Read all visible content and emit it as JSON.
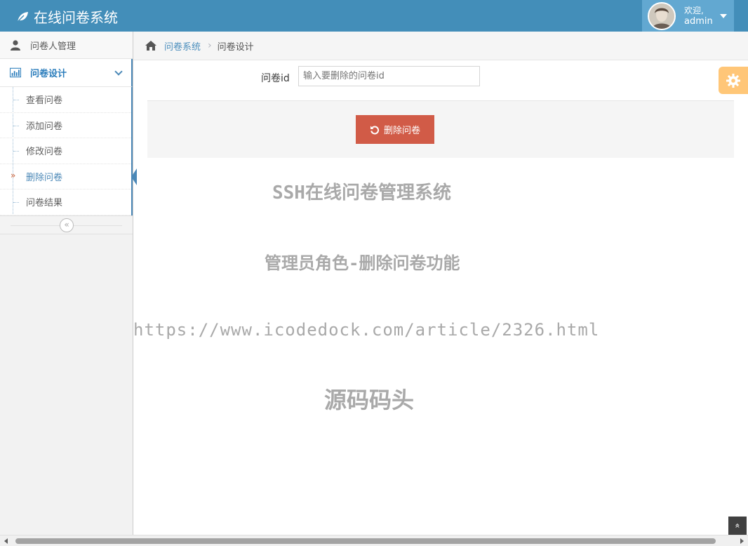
{
  "header": {
    "brand": "在线问卷系统",
    "brand_icon": "leaf-icon",
    "user_greeting": "欢迎,",
    "username": "admin"
  },
  "sidebar": {
    "items": [
      {
        "label": "问卷人管理",
        "icon": "user-icon"
      },
      {
        "label": "问卷设计",
        "icon": "bar-chart-icon",
        "open": true
      }
    ],
    "submenu": [
      {
        "label": "查看问卷"
      },
      {
        "label": "添加问卷"
      },
      {
        "label": "修改问卷"
      },
      {
        "label": "删除问卷",
        "active": true
      },
      {
        "label": "问卷结果"
      }
    ],
    "collapse_icon": "double-chevron-left-icon"
  },
  "breadcrumb": {
    "home_icon": "home-icon",
    "link": "问卷系统",
    "current": "问卷设计"
  },
  "form": {
    "label": "问卷id",
    "input_placeholder": "输入要删除的问卷id",
    "input_value": "",
    "delete_label": "删除问卷",
    "delete_icon": "undo-icon"
  },
  "watermark": {
    "line1": "SSH在线问卷管理系统",
    "line2": "管理员角色-删除问卷功能",
    "line3": "https://www.icodedock.com/article/2326.html",
    "line4": "源码码头"
  },
  "colors": {
    "navbar": "#438eb9",
    "user_menu": "#62a8d1",
    "delete_button": "#d15b47",
    "settings_button": "#ffb44b"
  }
}
